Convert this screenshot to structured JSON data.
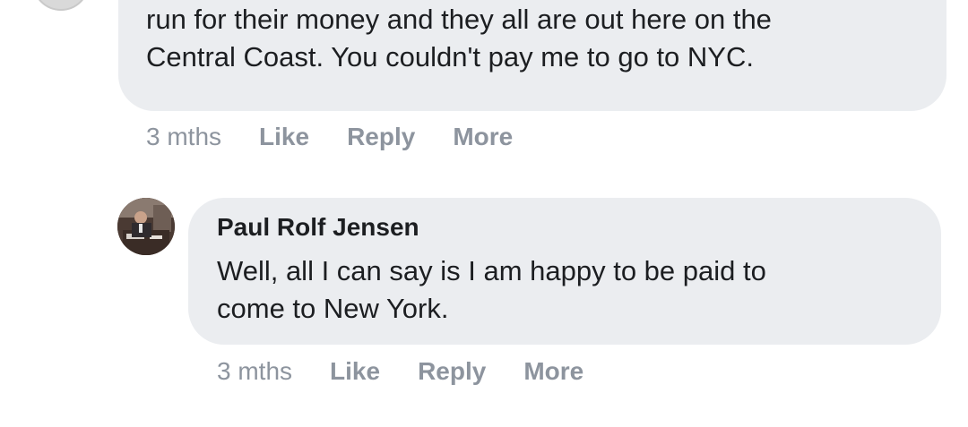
{
  "comments": [
    {
      "text": "Jocko's, A.J. Spurs, and Old West would give them a\nrun for their money and they all are out here on the\nCentral Coast. You couldn't pay me to go to NYC.",
      "time": "3 mths",
      "actions": [
        "Like",
        "Reply",
        "More"
      ]
    },
    {
      "author": "Paul Rolf Jensen",
      "text": "Well, all I can say is I am happy to be paid to\ncome to New York.",
      "time": "3 mths",
      "actions": [
        "Like",
        "Reply",
        "More"
      ]
    }
  ],
  "colors": {
    "bubble": "#ebedf0",
    "text": "#1c1e21",
    "meta": "#8d949e"
  }
}
